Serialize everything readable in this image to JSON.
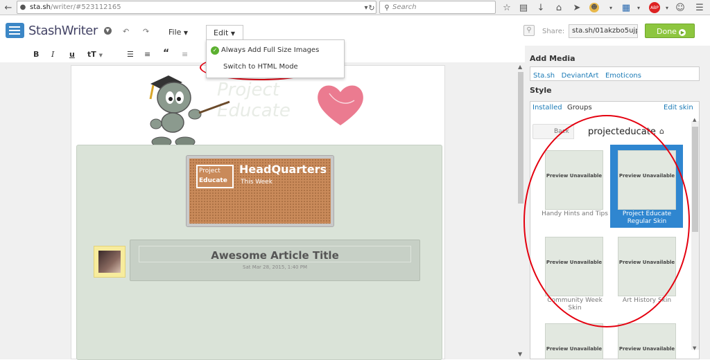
{
  "browser": {
    "url_host": "sta.sh",
    "url_path": "/writer/#523112165",
    "search_placeholder": "Search"
  },
  "app": {
    "logo": "StashWriter",
    "menu_file": "File",
    "menu_edit": "Edit",
    "share_label": "Share:",
    "share_url": "sta.sh/01akzbo5ujp",
    "done_label": "Done"
  },
  "edit_menu": {
    "items": [
      "Always Add Full Size Images",
      "Switch to HTML Mode"
    ]
  },
  "format_toolbar": {
    "bold": "B",
    "italic": "I",
    "underline": "u",
    "text_size": "tT",
    "quote": "“"
  },
  "document": {
    "watermark": "Project Educate",
    "board_logo_line1": "Project",
    "board_logo_line2": "Educate",
    "board_title": "HeadQuarters",
    "board_subtitle": "This Week",
    "article_title": "Awesome Article Title",
    "article_date": "Sat Mar 28, 2015, 1:40 PM"
  },
  "sidebar": {
    "add_media_heading": "Add Media",
    "media_links": [
      "Sta.sh",
      "DeviantArt",
      "Emoticons"
    ],
    "style_heading": "Style",
    "style_tabs": [
      "Installed",
      "Groups"
    ],
    "edit_skin": "Edit skin",
    "back_label": "Back",
    "group_name": "projecteducate",
    "preview_text": "Preview Unavailable",
    "skins": [
      {
        "name": "Handy Hints and Tips",
        "selected": false
      },
      {
        "name": "Project Educate Regular Skin",
        "selected": true
      },
      {
        "name": "Community Week Skin",
        "selected": false
      },
      {
        "name": "Art History Skin",
        "selected": false
      },
      {
        "name": "",
        "selected": false
      },
      {
        "name": "",
        "selected": false
      }
    ]
  },
  "colors": {
    "accent": "#2f86d0",
    "done_button": "#8dc63f",
    "annotation": "#e4000f"
  }
}
